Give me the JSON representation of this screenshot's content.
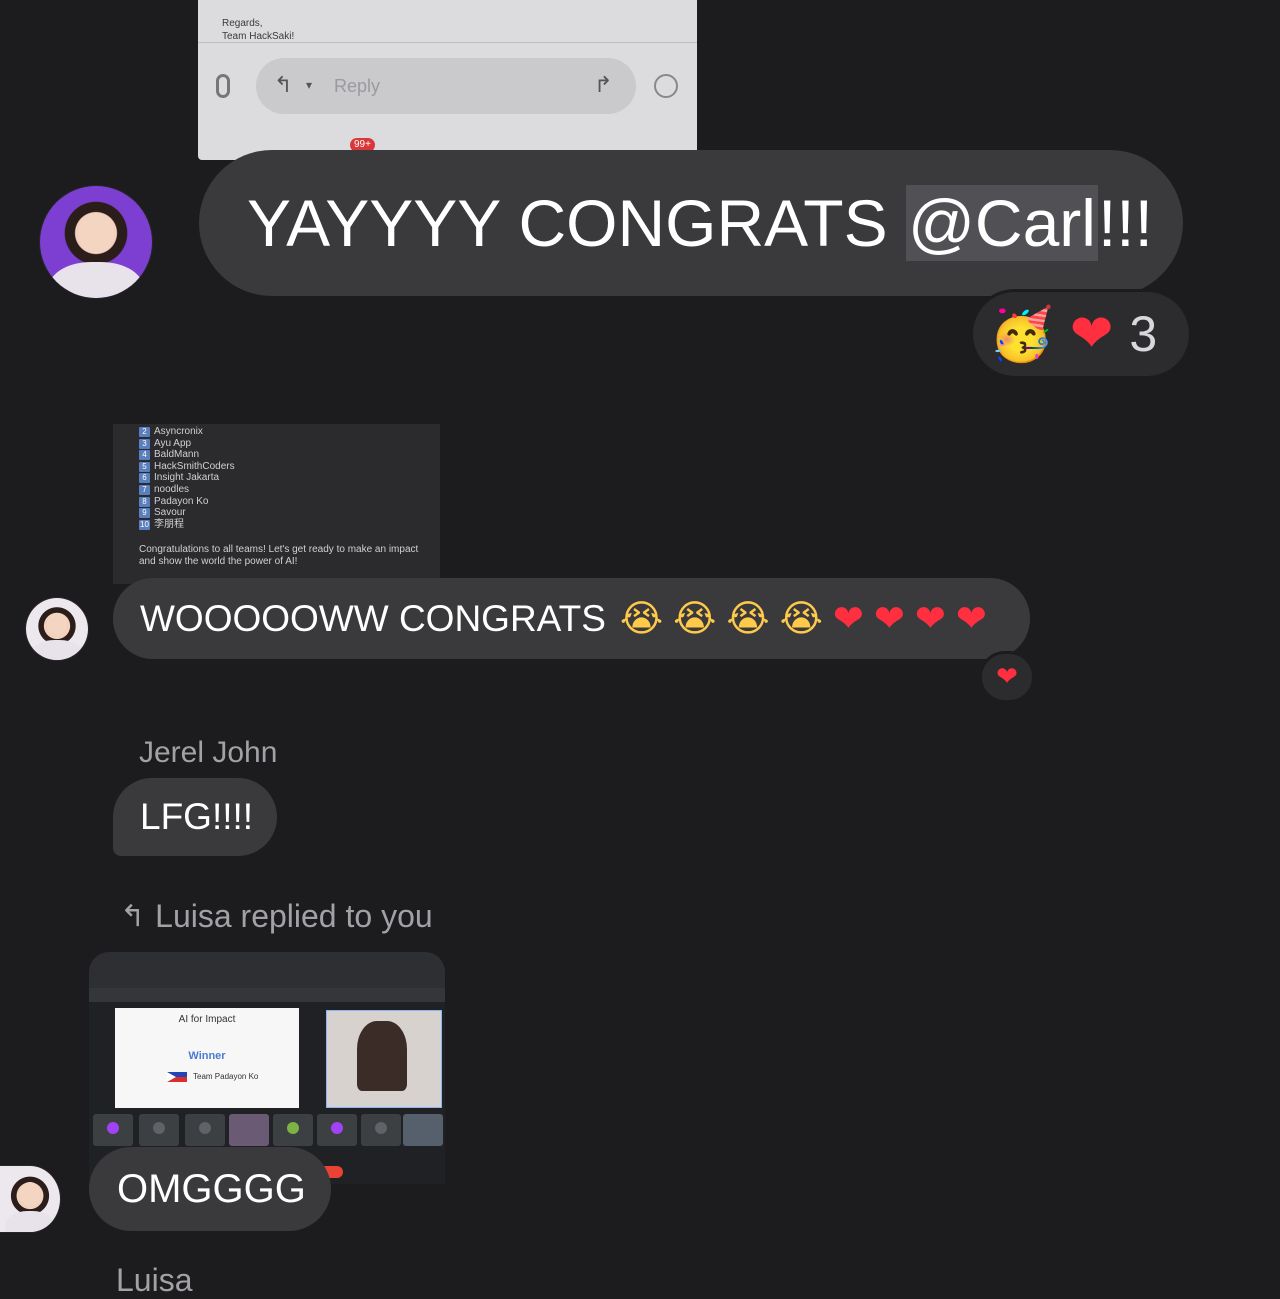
{
  "email_preview": {
    "regards": "Regards,",
    "signature": "Team HackSaki!",
    "reply_placeholder": "Reply",
    "badge": "99+"
  },
  "messages": [
    {
      "text_plain": "YAYYYY CONGRATS ",
      "mention": "@Carl",
      "text_after": "!!!",
      "reactions": {
        "emoji_1": "🥳",
        "emoji_2": "❤",
        "count": "3"
      }
    },
    {
      "text": "WOOOOOWW CONGRATS",
      "emojis": [
        "😭",
        "😭",
        "😭",
        "😭",
        "❤",
        "❤",
        "❤",
        "❤"
      ],
      "reaction": "❤"
    },
    {
      "sender": "Jerel John",
      "text": "LFG!!!!"
    },
    {
      "reply_header": "Luisa replied to you",
      "text": "OMGGGG"
    }
  ],
  "leaderboard": {
    "items": [
      {
        "num": "2",
        "name": "Asyncronix"
      },
      {
        "num": "3",
        "name": "Ayu App"
      },
      {
        "num": "4",
        "name": "BaldMann"
      },
      {
        "num": "5",
        "name": "HackSmithCoders"
      },
      {
        "num": "6",
        "name": "Insight Jakarta"
      },
      {
        "num": "7",
        "name": "noodles"
      },
      {
        "num": "8",
        "name": "Padayon Ko"
      },
      {
        "num": "9",
        "name": "Savour"
      },
      {
        "num": "10",
        "name": "李朋程"
      }
    ],
    "footer": "Congratulations to all teams! Let's get ready to make an impact and show the world the power of AI!"
  },
  "meeting": {
    "slide_title": "AI for Impact",
    "slide_winner": "Winner",
    "slide_team": "Team Padayon Ko"
  },
  "partial_name": "Luisa",
  "colors": {
    "background": "#1c1c1e",
    "bubble": "#3a3a3c",
    "heart": "#ff2f3f",
    "mention_highlight": "#505055"
  }
}
